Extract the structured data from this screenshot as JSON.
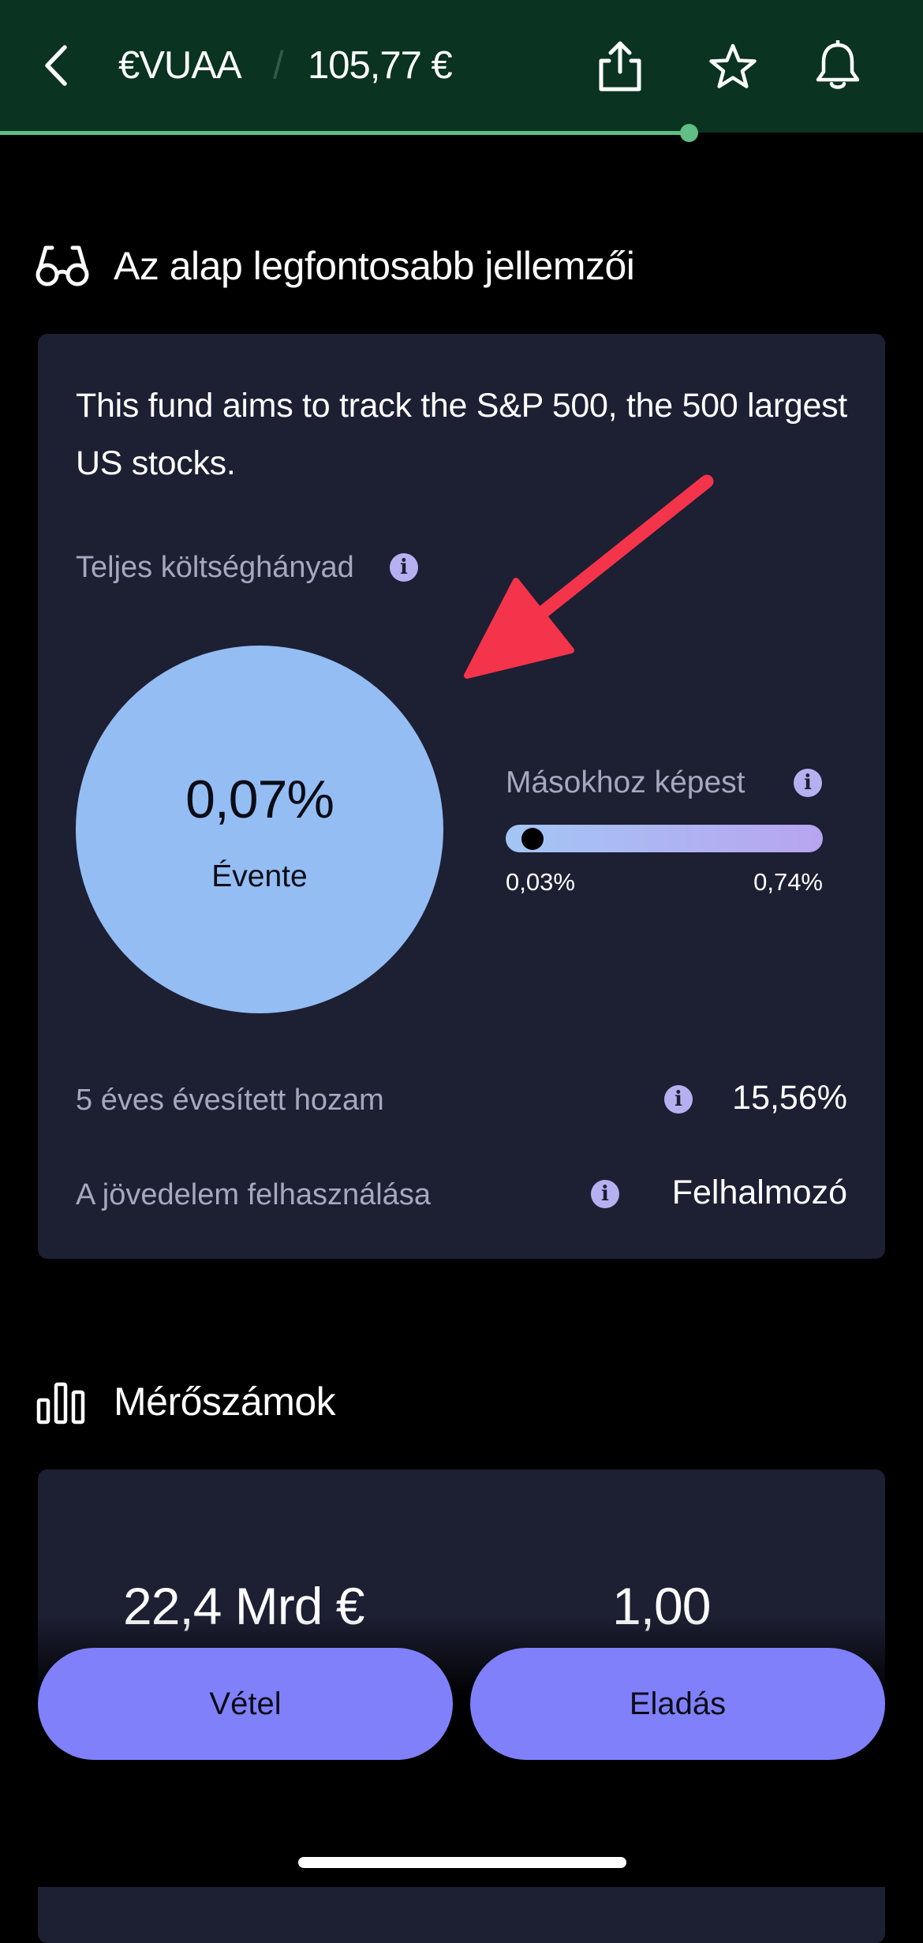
{
  "header": {
    "ticker": "€VUAA",
    "separator": "/",
    "price": "105,77 €",
    "icons": {
      "back": "chevron-left-icon",
      "share": "share-icon",
      "favorite": "star-icon",
      "alert": "bell-icon"
    },
    "progress": 0.75
  },
  "key_features": {
    "title": "Az alap legfontosabb jellemzői",
    "icon": "glasses-icon",
    "description": "This fund aims to track the S&P 500, the 500 largest US stocks.",
    "ter_label": "Teljes költséghányad",
    "ter_value": "0,07%",
    "ter_period": "Évente",
    "comparison": {
      "label": "Másokhoz képest",
      "min": "0,03%",
      "max": "0,74%"
    },
    "rows": [
      {
        "label": "5 éves évesített hozam",
        "value": "15,56%"
      },
      {
        "label": "A jövedelem felhasználása",
        "value": "Felhalmozó"
      }
    ]
  },
  "metrics": {
    "title": "Mérőszámok",
    "icon": "bar-chart-icon",
    "values": [
      "22,4 Mrd €",
      "1,00"
    ]
  },
  "actions": {
    "buy": "Vétel",
    "sell": "Eladás"
  },
  "colors": {
    "header_bg": "#0a3321",
    "accent_green": "#5fbf85",
    "card_bg": "#1d1f33",
    "circle": "#94bdf3",
    "button": "#8080fb",
    "annotation_arrow": "#f4344a"
  }
}
